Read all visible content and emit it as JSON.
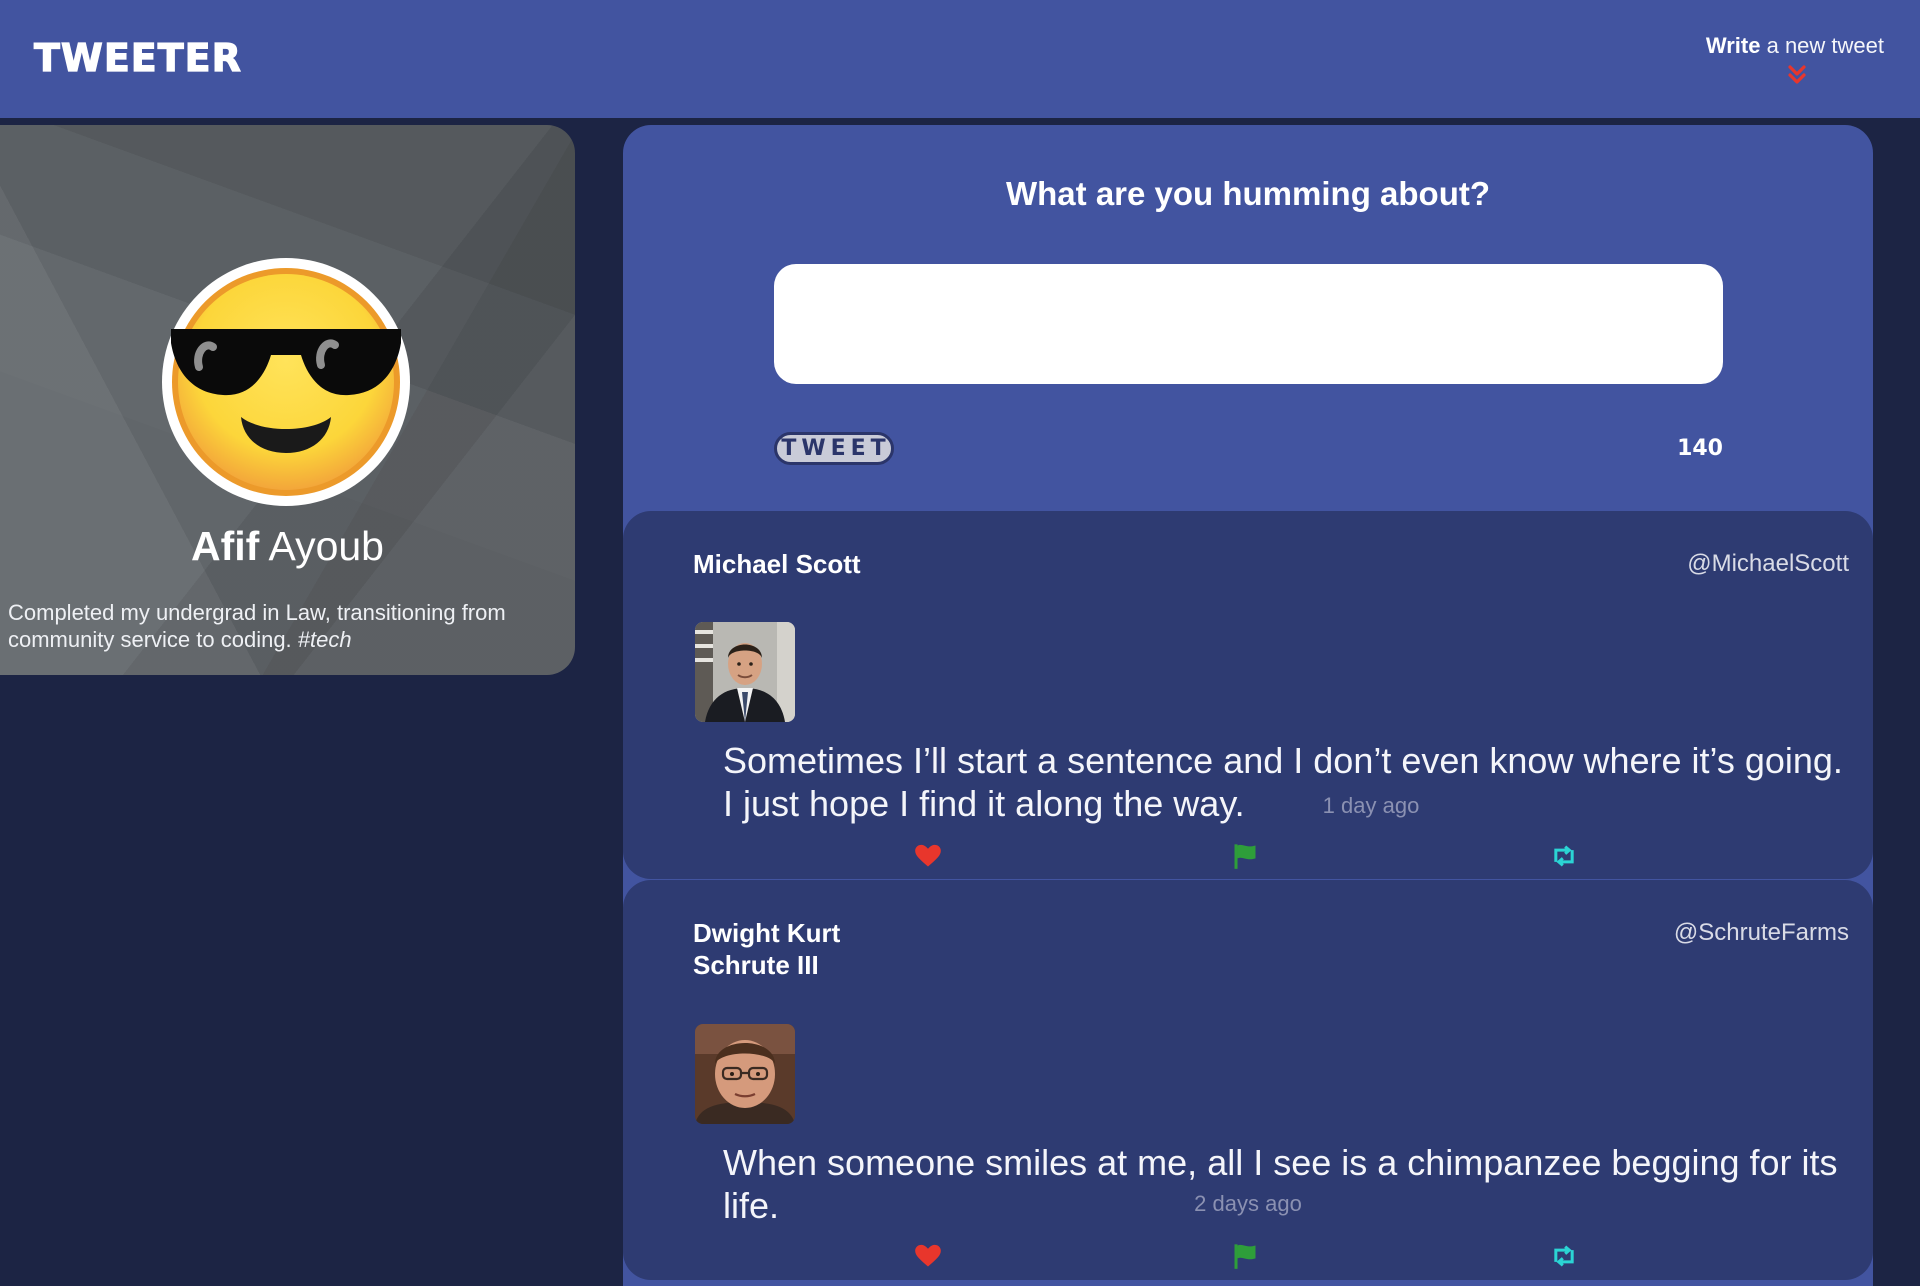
{
  "nav": {
    "brand": "TWEETER",
    "compose_bold": "Write",
    "compose_rest": " a new tweet",
    "chevron_color": "#e8362c"
  },
  "profile": {
    "first_name": "Afif",
    "last_name": "Ayoub",
    "bio": "Completed my undergrad in Law, transitioning from community service to coding. ",
    "bio_tag": "#tech",
    "avatar_icon": "sunglasses-emoji-icon"
  },
  "composer": {
    "prompt": "What are you humming about?",
    "input_value": "",
    "button_label": "TWEET",
    "char_count": "140"
  },
  "tweets": [
    {
      "name": "Michael Scott",
      "handle": "@MichaelScott",
      "text": "Sometimes I’ll start a sentence and I don’t even know where it’s going. I just hope I find it along the way.",
      "time": "1 day ago"
    },
    {
      "name": "Dwight Kurt Schrute III",
      "handle": "@SchruteFarms",
      "text": "When someone smiles at me, all I see is a chimpanzee begging for its life.",
      "time": "2 days ago"
    }
  ],
  "actions": {
    "like_color": "#e8362c",
    "flag_color": "#2e9e3a",
    "retweet_color": "#2bd4d4"
  }
}
